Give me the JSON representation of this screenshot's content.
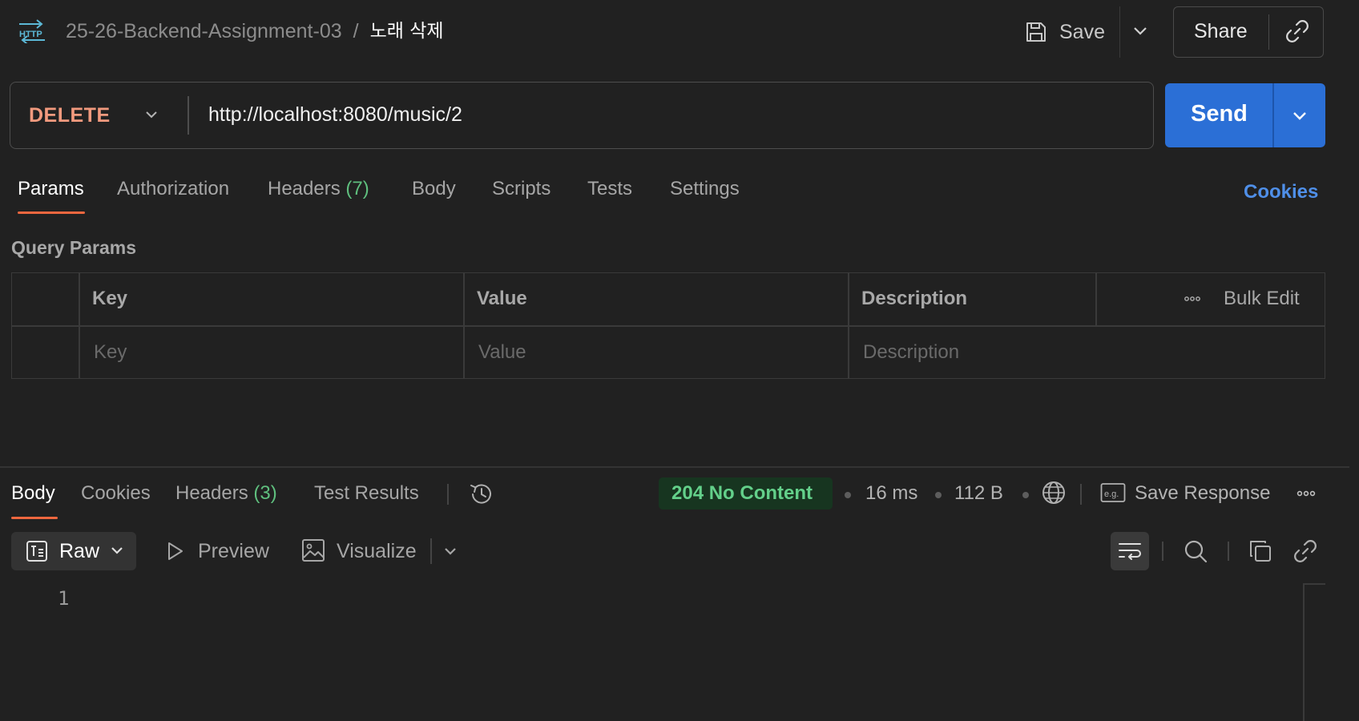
{
  "breadcrumb": {
    "collection": "25-26-Backend-Assignment-03",
    "separator": "/",
    "request_name": "노래 삭제"
  },
  "header": {
    "save_label": "Save",
    "share_label": "Share"
  },
  "request": {
    "method": "DELETE",
    "url": "http://localhost:8080/music/2",
    "send_label": "Send"
  },
  "request_tabs": {
    "params": "Params",
    "authorization": "Authorization",
    "headers": "Headers",
    "headers_count": "(7)",
    "body": "Body",
    "scripts": "Scripts",
    "tests": "Tests",
    "settings": "Settings",
    "active": "Params"
  },
  "cookies_link": "Cookies",
  "query_params": {
    "title": "Query Params",
    "columns": {
      "key": "Key",
      "value": "Value",
      "description": "Description"
    },
    "bulk_edit": "Bulk Edit",
    "placeholders": {
      "key": "Key",
      "value": "Value",
      "description": "Description"
    }
  },
  "response_tabs": {
    "body": "Body",
    "cookies": "Cookies",
    "headers": "Headers",
    "headers_count": "(3)",
    "test_results": "Test Results",
    "active": "Body"
  },
  "response_meta": {
    "status": "204 No Content",
    "time": "16 ms",
    "size": "112 B",
    "save_response": "Save Response"
  },
  "viewer": {
    "format": "Raw",
    "preview": "Preview",
    "visualize": "Visualize",
    "line_numbers": [
      "1"
    ]
  },
  "colors": {
    "background": "#212121",
    "method_delete": "#f29a7e",
    "send_button": "#2b6fd6",
    "tab_underline": "#f0673f",
    "count_green": "#5fbf7e",
    "status_success": "#63d08a",
    "cookies_link": "#4f8fe8"
  },
  "icons": {
    "http": "http-icon",
    "save": "save-icon",
    "link": "link-icon",
    "history": "history-icon",
    "globe": "globe-icon",
    "example": "eg-icon",
    "more": "more-horizontal-icon",
    "raw": "text-format-icon",
    "preview": "play-icon",
    "visualize": "image-icon",
    "wrap": "wrap-lines-icon",
    "search": "search-icon",
    "copy": "copy-icon"
  }
}
